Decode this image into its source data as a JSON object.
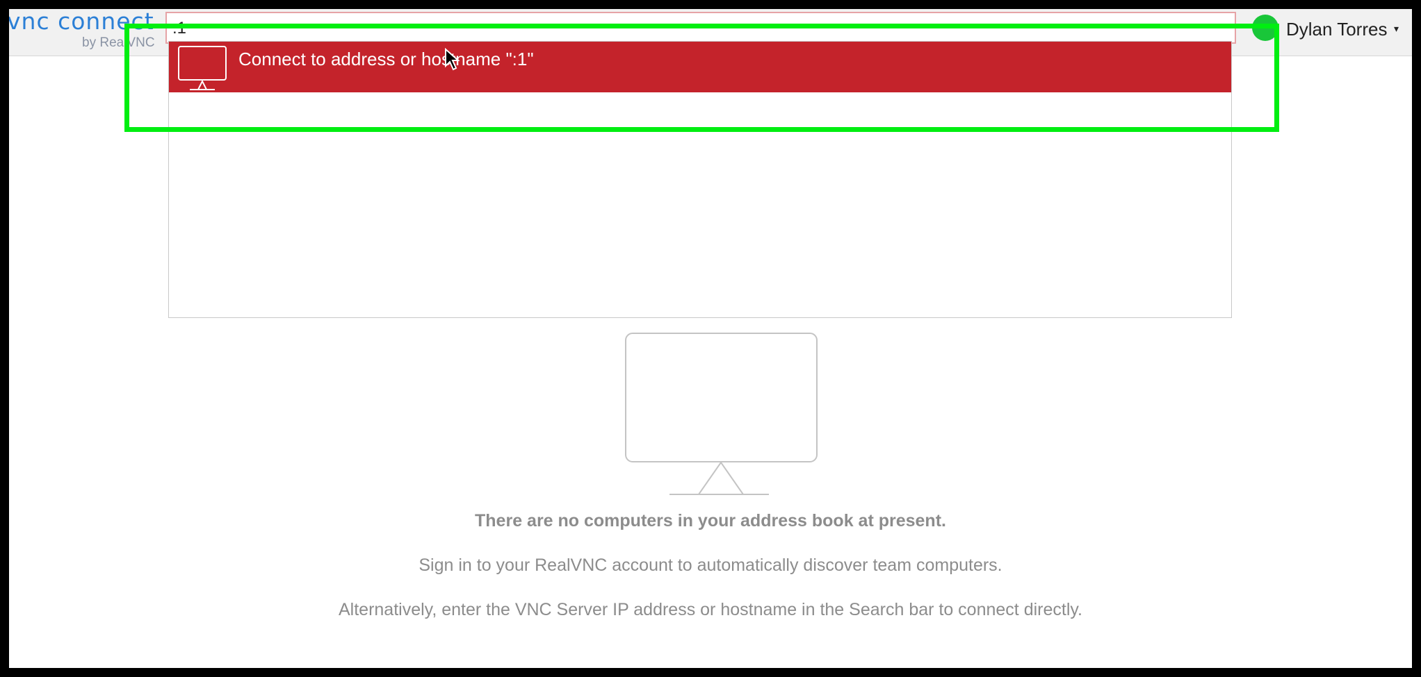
{
  "app": {
    "logo_text": "vnc connect",
    "logo_subtext": "by RealVNC"
  },
  "search": {
    "value": ":1",
    "placeholder": ""
  },
  "dropdown": {
    "suggestion_label": "Connect to address or hostname \":1\"",
    "suggestion_icon": "monitor-icon"
  },
  "user": {
    "name": "Dylan Torres",
    "caret": "▾",
    "status_color": "#19c639"
  },
  "empty_state": {
    "icon": "monitor-icon",
    "title": "There are no computers in your address book at present.",
    "line1": "Sign in to your RealVNC account to automatically discover team computers.",
    "line2": "Alternatively, enter the VNC Server IP address or hostname in the Search bar to connect directly."
  },
  "colors": {
    "accent": "#c4232b",
    "brand_blue": "#2b7fd6",
    "highlight": "#00ee11"
  }
}
